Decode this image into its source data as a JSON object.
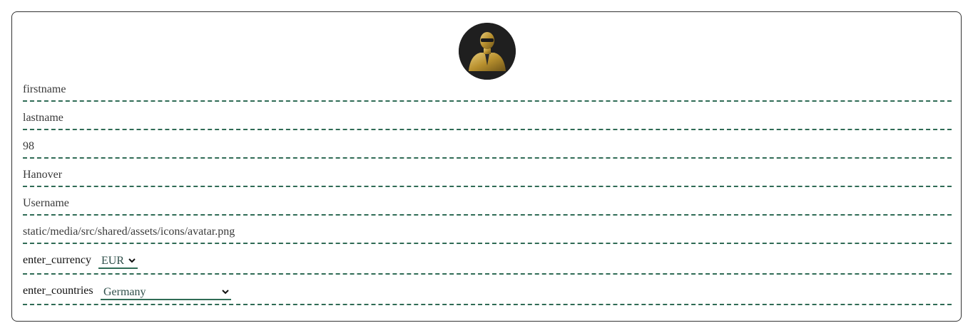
{
  "avatar": {
    "alt": "avatar"
  },
  "fields": {
    "firstname": "firstname",
    "lastname": "lastname",
    "age": "98",
    "city": "Hanover",
    "username": "Username",
    "avatar_path": "static/media/src/shared/assets/icons/avatar.png"
  },
  "currency": {
    "label": "enter_currency",
    "value": "EUR"
  },
  "countries": {
    "label": "enter_countries",
    "value": "Germany"
  },
  "colors": {
    "dashed_border": "#2f6b55",
    "avatar_bg": "#1f1f1f",
    "avatar_gold": "#c8a245"
  }
}
